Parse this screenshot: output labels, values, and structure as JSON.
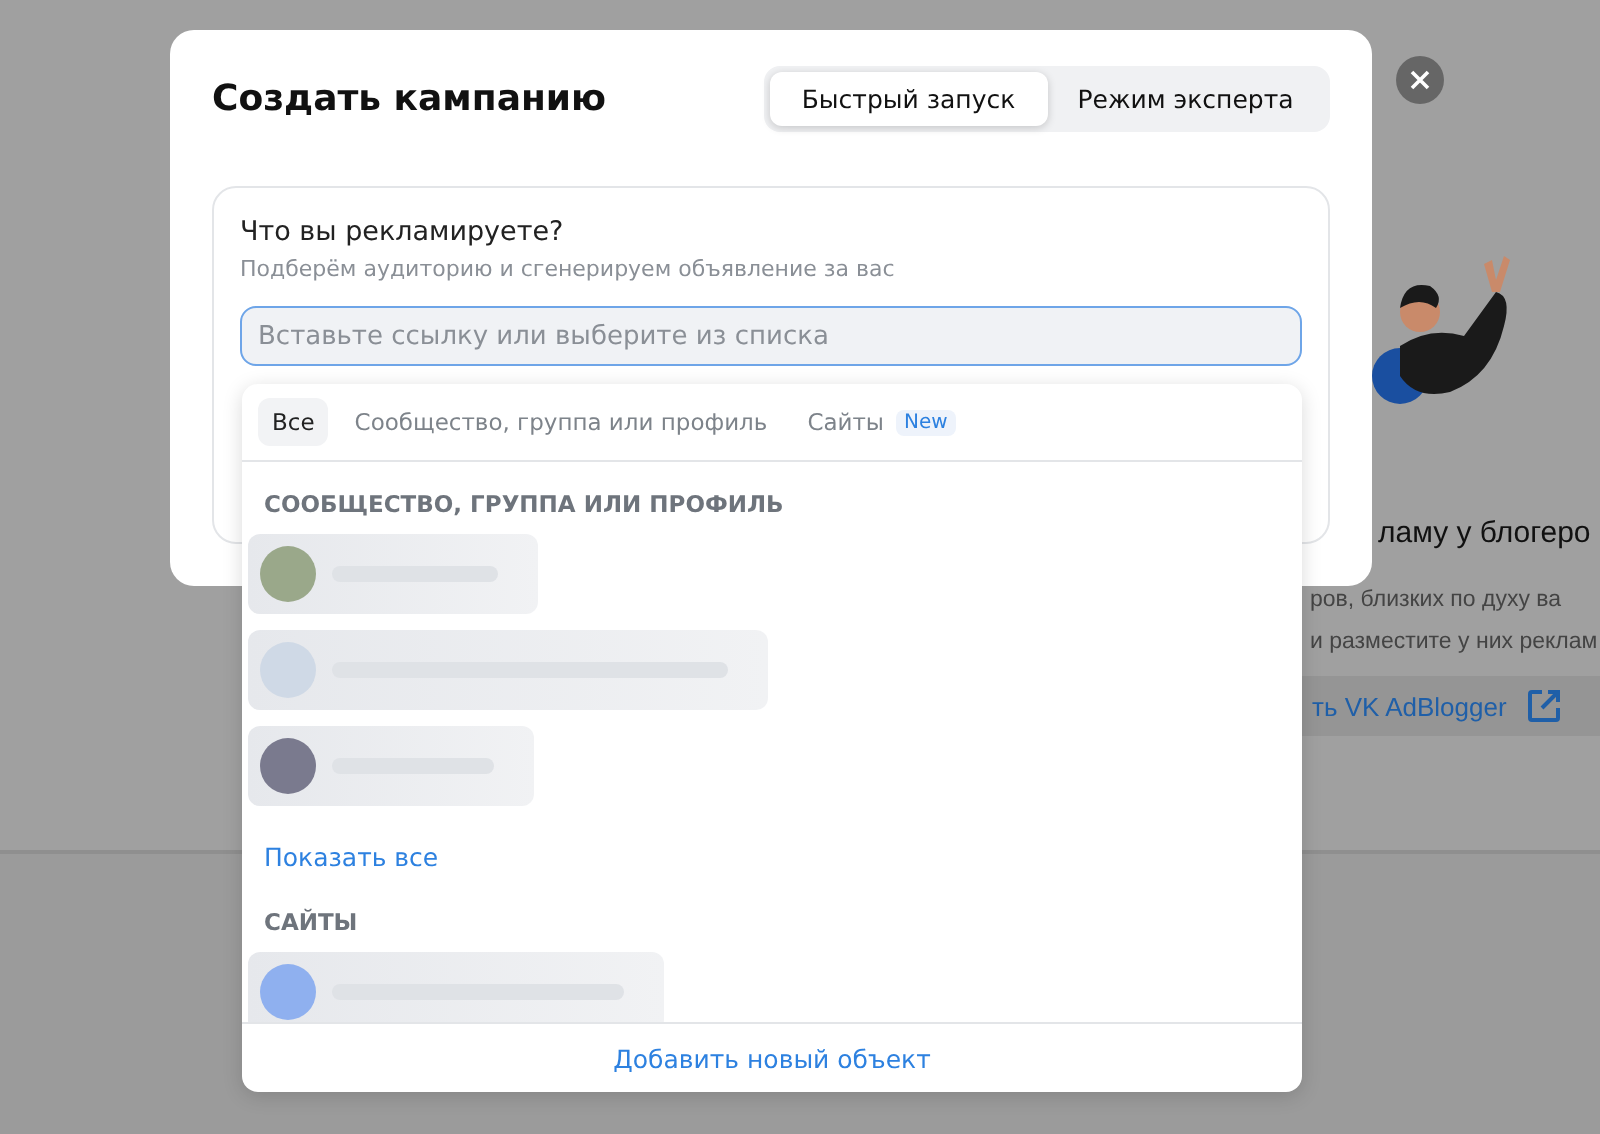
{
  "background": {
    "heading": "ламу у блогеро",
    "text_lines": [
      "ров, близких по духу ва",
      "и разместите у них реклам"
    ],
    "link": "ть VK AdBlogger"
  },
  "dialog": {
    "title": "Создать кампанию",
    "mode_tabs": [
      {
        "label": "Быстрый запуск",
        "selected": true
      },
      {
        "label": "Режим эксперта",
        "selected": false
      }
    ],
    "question": "Что вы рекламируете?",
    "hint": "Подберём аудиторию и сгенерируем объявление за вас",
    "search": {
      "placeholder": "Вставьте ссылку или выберите из списка"
    }
  },
  "dropdown": {
    "filters": [
      {
        "label": "Все",
        "selected": true
      },
      {
        "label": "Сообщество, группа или профиль",
        "selected": false
      },
      {
        "label": "Сайты",
        "selected": false,
        "badge": "New"
      }
    ],
    "sections": [
      {
        "heading": "СООБЩЕСТВО, ГРУППА ИЛИ ПРОФИЛЬ",
        "show_all": "Показать все"
      },
      {
        "heading": "САЙТЫ"
      }
    ],
    "footer": "Добавить новый объект"
  }
}
